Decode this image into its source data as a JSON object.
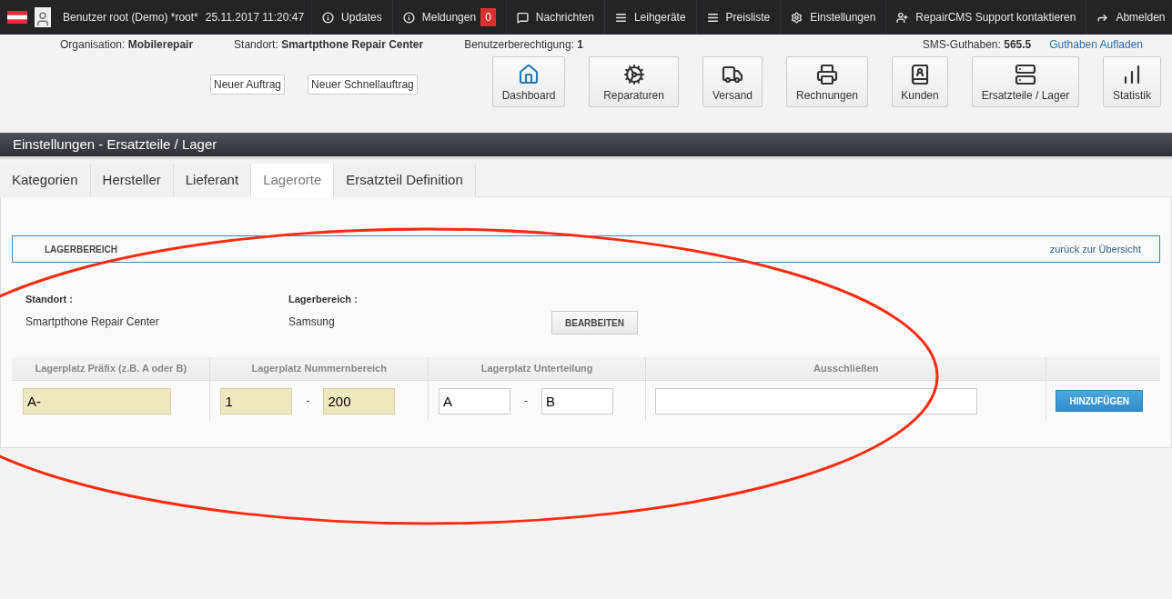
{
  "top_bar": {
    "user": "Benutzer root (Demo) *root*",
    "datetime": "25.11.2017 11:20:47",
    "items": [
      {
        "label": "Updates"
      },
      {
        "label": "Meldungen",
        "badge": "0"
      },
      {
        "label": "Nachrichten"
      },
      {
        "label": "Leihgeräte"
      },
      {
        "label": "Preisliste"
      },
      {
        "label": "Einstellungen"
      },
      {
        "label": "RepairCMS Support kontaktieren"
      },
      {
        "label": "Abmelden"
      }
    ]
  },
  "info": [
    {
      "label": "Organisation:",
      "value": "Mobilerepair"
    },
    {
      "label": "Standort:",
      "value": "Smartpthone Repair Center"
    },
    {
      "label": "Benutzerberechtigung:",
      "value": "1"
    }
  ],
  "sms": {
    "label": "SMS-Guthaben:",
    "value": "565.5",
    "link": "Guthaben Aufladen"
  },
  "quick_buttons": [
    "Neuer Auftrag",
    "Neuer Schnellauftrag"
  ],
  "nav_buttons": [
    "Dashboard",
    "Reparaturen",
    "Versand",
    "Rechnungen",
    "Kunden",
    "Ersatzteile / Lager",
    "Statistik"
  ],
  "page_title": "Einstellungen - Ersatzteile / Lager",
  "tabs": [
    {
      "label": "Kategorien",
      "selected": false
    },
    {
      "label": "Hersteller",
      "selected": false
    },
    {
      "label": "Lieferant",
      "selected": false
    },
    {
      "label": "Lagerorte",
      "selected": true
    },
    {
      "label": "Ersatzteil Definition",
      "selected": false
    }
  ],
  "section": {
    "title": "LAGERBEREICH",
    "back_link": "zurück zur Übersicht"
  },
  "details": [
    {
      "label": "Standort :",
      "value": "Smartpthone Repair Center"
    },
    {
      "label": "Lagerbereich :",
      "value": "Samsung"
    }
  ],
  "edit_button": "BEARBEITEN",
  "table": {
    "columns": [
      "Lagerplatz Präfix (z.B. A oder B)",
      "Lagerplatz Nummernbereich",
      "Lagerplatz Unterteilung",
      "Ausschließen"
    ],
    "prefix": "A-",
    "range_from": "1",
    "range_to": "200",
    "range_separator": "-",
    "sub_from": "A",
    "sub_to": "B",
    "sub_separator": "-",
    "add_button": "HINZUFÜGEN"
  }
}
